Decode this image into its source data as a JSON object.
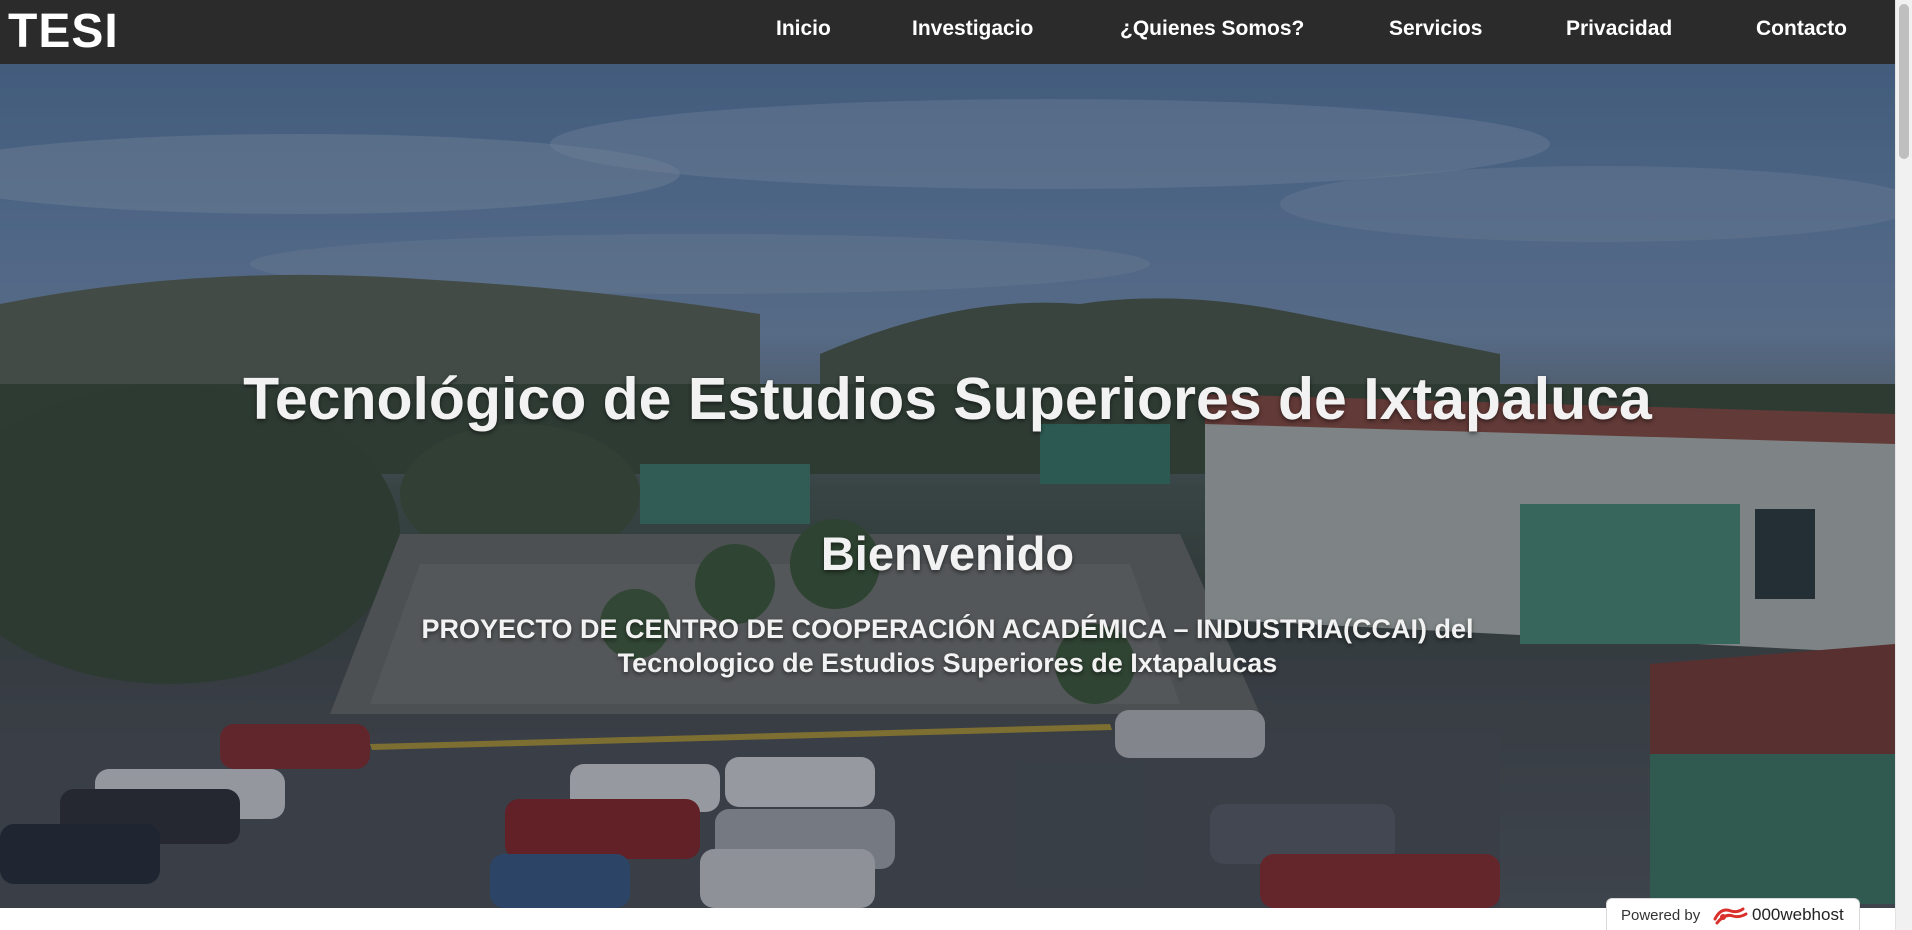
{
  "header": {
    "brand": "TESI",
    "nav": [
      "Inicio",
      "Investigacio",
      "¿Quienes Somos?",
      "Servicios",
      "Privacidad",
      "Contacto"
    ]
  },
  "hero": {
    "title": "Tecnológico de Estudios Superiores de Ixtapaluca",
    "subtitle": "Bienvenido",
    "description": "PROYECTO DE CENTRO DE COOPERACIÓN ACADÉMICA – INDUSTRIA(CCAI) del Tecnologico de Estudios Superiores de Ixtapalucas"
  },
  "badge": {
    "powered_label": "Powered by",
    "host_name": "000webhost"
  },
  "colors": {
    "navbar": "#2b2b2b",
    "nav_text": "#ffffff",
    "hero_text": "#f2f2f2"
  }
}
